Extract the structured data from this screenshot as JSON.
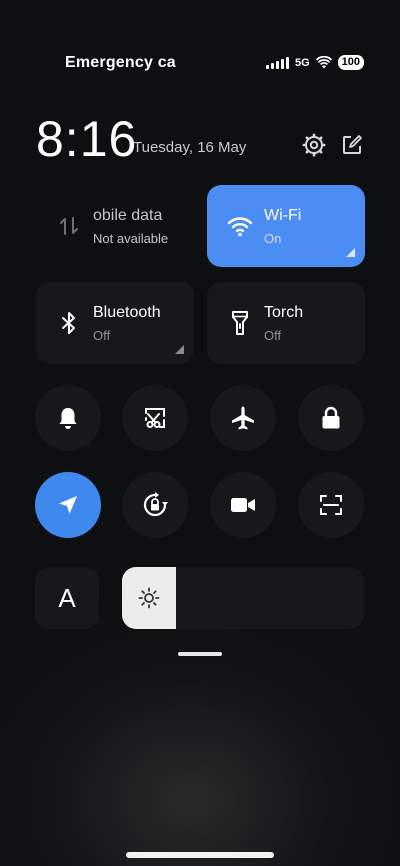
{
  "status": {
    "carrier": "Emergency ca",
    "network": "5G",
    "battery": "100"
  },
  "header": {
    "time": "8:16",
    "date": "Tuesday, 16 May"
  },
  "tiles": {
    "mobile_data": {
      "label": "obile data",
      "sub": "Not available",
      "icon": "mobile-data-icon"
    },
    "wifi": {
      "label": "Wi-Fi",
      "sub": "On",
      "icon": "wifi-icon"
    },
    "bluetooth": {
      "label": "Bluetooth",
      "sub": "Off",
      "icon": "bluetooth-icon"
    },
    "torch": {
      "label": "Torch",
      "sub": "Off",
      "icon": "torch-icon"
    }
  },
  "toggles": [
    "bell-icon",
    "screenshot-icon",
    "airplane-icon",
    "lock-icon",
    "location-icon",
    "rotation-lock-icon",
    "video-icon",
    "scan-icon"
  ],
  "font_button": {
    "label": "A"
  },
  "brightness": {
    "level": 0.22
  },
  "colors": {
    "accent": "#4b8df2",
    "tile": "#15191c"
  }
}
